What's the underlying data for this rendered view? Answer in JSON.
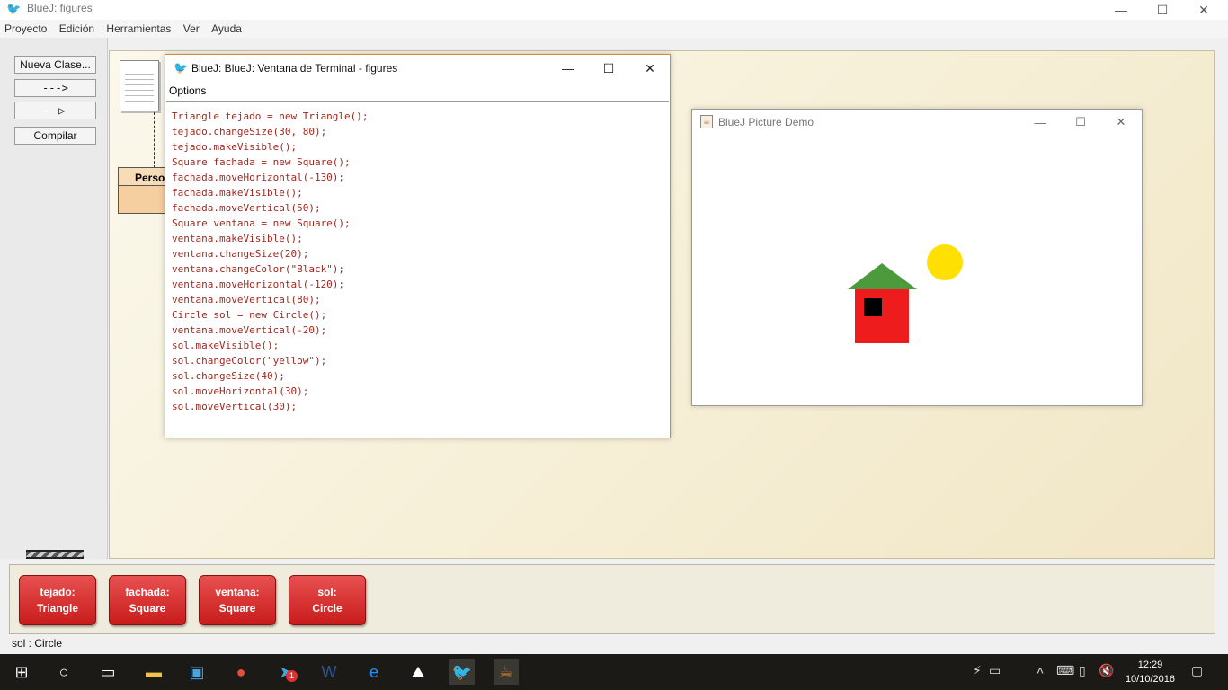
{
  "main_window": {
    "title": "BlueJ:  figures",
    "menu": [
      "Proyecto",
      "Edición",
      "Herramientas",
      "Ver",
      "Ayuda"
    ],
    "toolbar": {
      "new_class": "Nueva Clase...",
      "dashed_arrow": "--->",
      "solid_arrow": "——▷",
      "compile": "Compilar"
    },
    "class_box": {
      "name": "Person"
    },
    "objects": [
      {
        "name": "tejado:",
        "type": "Triangle"
      },
      {
        "name": "fachada:",
        "type": "Square"
      },
      {
        "name": "ventana:",
        "type": "Square"
      },
      {
        "name": "sol:",
        "type": "Circle"
      }
    ],
    "status": "sol : Circle"
  },
  "terminal": {
    "title": "BlueJ: BlueJ:  Ventana de Terminal - figures",
    "menu_label": "Options",
    "lines": [
      "Triangle tejado = new Triangle();",
      "tejado.changeSize(30, 80);",
      "tejado.makeVisible();",
      "Square fachada = new Square();",
      "fachada.moveHorizontal(-130);",
      "fachada.makeVisible();",
      "fachada.moveVertical(50);",
      "Square ventana = new Square();",
      "ventana.makeVisible();",
      "ventana.changeSize(20);",
      "ventana.changeColor(\"Black\");",
      "ventana.moveHorizontal(-120);",
      "ventana.moveVertical(80);",
      "Circle sol = new Circle();",
      "ventana.moveVertical(-20);",
      "sol.makeVisible();",
      "sol.changeColor(\"yellow\");",
      "sol.changeSize(40);",
      "sol.moveHorizontal(30);",
      "sol.moveVertical(30);"
    ]
  },
  "picture_window": {
    "title": "BlueJ Picture Demo"
  },
  "taskbar": {
    "time": "12:29",
    "date": "10/10/2016",
    "telegram_badge": "1"
  },
  "colors": {
    "wall": "#ee1c1c",
    "roof": "#4c9a3c",
    "window": "#000000",
    "sun": "#ffe000",
    "object_red": "#d42020"
  }
}
